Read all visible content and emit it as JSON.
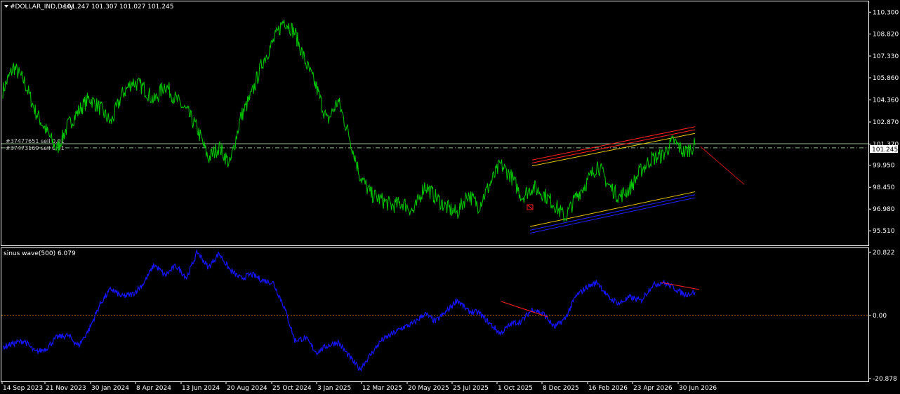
{
  "header": {
    "symbol_label": "#DOLLAR_IND,Daily",
    "ohlc": "101.247 101.307 101.027 101.245"
  },
  "colors": {
    "background": "#000000",
    "price_line": "#00c800",
    "indicator_line": "#1414ff",
    "grid_frame": "#ffffff",
    "order_line": "#8fbc8f",
    "trend_red": "#ff2020",
    "trend_yellow": "#e6c800",
    "trend_blue": "#2020ff",
    "zero_line": "#c86400"
  },
  "orders": [
    {
      "label": "#37477651 sell 0.01",
      "price": 101.4
    },
    {
      "label": "#37473169 sell 0.01",
      "price": 101.12
    }
  ],
  "current_price_label": "101.245",
  "indicator": {
    "label": "sinus wave(500) 6.079",
    "zero_label": "0.00"
  },
  "chart_data": [
    {
      "type": "line",
      "title": "#DOLLAR_IND,Daily",
      "ylim": [
        95.0,
        110.6
      ],
      "yticks": [
        "110.300",
        "108.820",
        "107.330",
        "105.860",
        "104.360",
        "102.870",
        "101.370",
        "99.950",
        "98.450",
        "96.980",
        "95.510"
      ],
      "ytick_values": [
        110.3,
        108.82,
        107.33,
        105.86,
        104.36,
        102.87,
        101.37,
        99.95,
        98.45,
        96.98,
        95.51
      ],
      "x": [
        "14 Sep 2023",
        "21 Nov 2023",
        "30 Jan 2024",
        "8 Apr 2024",
        "13 Jun 2024",
        "20 Aug 2024",
        "25 Oct 2024",
        "3 Jan 2025",
        "12 Mar 2025",
        "20 May 2025",
        "25 Jul 2025",
        "1 Oct 2025",
        "8 Dec 2025",
        "16 Feb 2026",
        "23 Apr 2026",
        "30 Jun 2026"
      ],
      "series": [
        {
          "values": [
            105.0,
            106.6,
            105.6,
            103.6,
            102.3,
            101.0,
            102.6,
            103.6,
            104.5,
            103.8,
            102.8,
            104.7,
            105.6,
            105.2,
            104.3,
            105.4,
            104.4,
            103.6,
            102.4,
            100.4,
            101.2,
            100.0,
            103.2,
            104.7,
            106.9,
            108.3,
            109.8,
            108.9,
            106.9,
            105.2,
            102.9,
            104.3,
            102.0,
            99.3,
            98.0,
            97.6,
            97.2,
            97.4,
            96.8,
            98.6,
            97.8,
            97.1,
            96.7,
            98.0,
            97.2,
            98.6,
            100.0,
            99.2,
            97.8,
            98.5,
            98.0,
            97.3,
            96.4,
            97.8,
            98.8,
            100.0,
            98.6,
            97.8,
            98.4,
            99.6,
            100.4,
            100.6,
            101.6,
            100.8,
            101.3
          ]
        }
      ],
      "annotations": [
        "#37477651 sell 0.01",
        "#37473169 sell 0.01"
      ]
    },
    {
      "type": "line",
      "title": "sinus wave(500) 6.079",
      "ylim": [
        -20.878,
        20.822
      ],
      "yticks": [
        "20.822",
        "0.00",
        "-20.878"
      ],
      "ytick_values": [
        20.822,
        0.0,
        -20.878
      ],
      "series": [
        {
          "values": [
            -10.5,
            -9.2,
            -8.4,
            -12.2,
            -11.0,
            -7.2,
            -6.6,
            -10.0,
            -4.5,
            3.8,
            8.8,
            6.2,
            7.0,
            10.5,
            16.8,
            13.2,
            16.4,
            12.5,
            21.0,
            15.8,
            20.5,
            15.0,
            12.2,
            13.6,
            11.6,
            10.8,
            3.0,
            -8.2,
            -7.5,
            -12.3,
            -10.0,
            -8.8,
            -13.5,
            -17.8,
            -13.0,
            -8.3,
            -6.2,
            -4.0,
            -2.6,
            0.6,
            -2.0,
            1.2,
            5.2,
            1.4,
            0.9,
            -2.6,
            -6.0,
            -2.8,
            -1.8,
            2.2,
            0.5,
            -4.0,
            -1.0,
            6.4,
            9.4,
            11.0,
            5.8,
            4.0,
            6.0,
            4.8,
            9.8,
            11.0,
            9.2,
            6.9,
            7.6
          ]
        }
      ]
    }
  ]
}
